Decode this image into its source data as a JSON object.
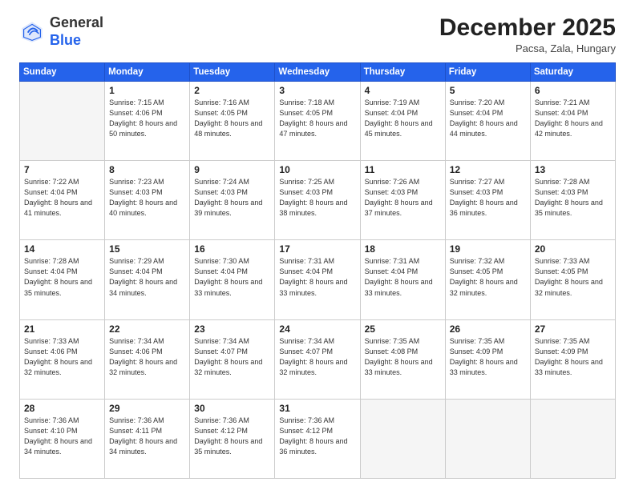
{
  "header": {
    "logo_general": "General",
    "logo_blue": "Blue",
    "month_title": "December 2025",
    "location": "Pacsa, Zala, Hungary"
  },
  "days_of_week": [
    "Sunday",
    "Monday",
    "Tuesday",
    "Wednesday",
    "Thursday",
    "Friday",
    "Saturday"
  ],
  "weeks": [
    [
      {
        "day": "",
        "info": ""
      },
      {
        "day": "1",
        "info": "Sunrise: 7:15 AM\nSunset: 4:06 PM\nDaylight: 8 hours\nand 50 minutes."
      },
      {
        "day": "2",
        "info": "Sunrise: 7:16 AM\nSunset: 4:05 PM\nDaylight: 8 hours\nand 48 minutes."
      },
      {
        "day": "3",
        "info": "Sunrise: 7:18 AM\nSunset: 4:05 PM\nDaylight: 8 hours\nand 47 minutes."
      },
      {
        "day": "4",
        "info": "Sunrise: 7:19 AM\nSunset: 4:04 PM\nDaylight: 8 hours\nand 45 minutes."
      },
      {
        "day": "5",
        "info": "Sunrise: 7:20 AM\nSunset: 4:04 PM\nDaylight: 8 hours\nand 44 minutes."
      },
      {
        "day": "6",
        "info": "Sunrise: 7:21 AM\nSunset: 4:04 PM\nDaylight: 8 hours\nand 42 minutes."
      }
    ],
    [
      {
        "day": "7",
        "info": "Sunrise: 7:22 AM\nSunset: 4:04 PM\nDaylight: 8 hours\nand 41 minutes."
      },
      {
        "day": "8",
        "info": "Sunrise: 7:23 AM\nSunset: 4:03 PM\nDaylight: 8 hours\nand 40 minutes."
      },
      {
        "day": "9",
        "info": "Sunrise: 7:24 AM\nSunset: 4:03 PM\nDaylight: 8 hours\nand 39 minutes."
      },
      {
        "day": "10",
        "info": "Sunrise: 7:25 AM\nSunset: 4:03 PM\nDaylight: 8 hours\nand 38 minutes."
      },
      {
        "day": "11",
        "info": "Sunrise: 7:26 AM\nSunset: 4:03 PM\nDaylight: 8 hours\nand 37 minutes."
      },
      {
        "day": "12",
        "info": "Sunrise: 7:27 AM\nSunset: 4:03 PM\nDaylight: 8 hours\nand 36 minutes."
      },
      {
        "day": "13",
        "info": "Sunrise: 7:28 AM\nSunset: 4:03 PM\nDaylight: 8 hours\nand 35 minutes."
      }
    ],
    [
      {
        "day": "14",
        "info": "Sunrise: 7:28 AM\nSunset: 4:04 PM\nDaylight: 8 hours\nand 35 minutes."
      },
      {
        "day": "15",
        "info": "Sunrise: 7:29 AM\nSunset: 4:04 PM\nDaylight: 8 hours\nand 34 minutes."
      },
      {
        "day": "16",
        "info": "Sunrise: 7:30 AM\nSunset: 4:04 PM\nDaylight: 8 hours\nand 33 minutes."
      },
      {
        "day": "17",
        "info": "Sunrise: 7:31 AM\nSunset: 4:04 PM\nDaylight: 8 hours\nand 33 minutes."
      },
      {
        "day": "18",
        "info": "Sunrise: 7:31 AM\nSunset: 4:04 PM\nDaylight: 8 hours\nand 33 minutes."
      },
      {
        "day": "19",
        "info": "Sunrise: 7:32 AM\nSunset: 4:05 PM\nDaylight: 8 hours\nand 32 minutes."
      },
      {
        "day": "20",
        "info": "Sunrise: 7:33 AM\nSunset: 4:05 PM\nDaylight: 8 hours\nand 32 minutes."
      }
    ],
    [
      {
        "day": "21",
        "info": "Sunrise: 7:33 AM\nSunset: 4:06 PM\nDaylight: 8 hours\nand 32 minutes."
      },
      {
        "day": "22",
        "info": "Sunrise: 7:34 AM\nSunset: 4:06 PM\nDaylight: 8 hours\nand 32 minutes."
      },
      {
        "day": "23",
        "info": "Sunrise: 7:34 AM\nSunset: 4:07 PM\nDaylight: 8 hours\nand 32 minutes."
      },
      {
        "day": "24",
        "info": "Sunrise: 7:34 AM\nSunset: 4:07 PM\nDaylight: 8 hours\nand 32 minutes."
      },
      {
        "day": "25",
        "info": "Sunrise: 7:35 AM\nSunset: 4:08 PM\nDaylight: 8 hours\nand 33 minutes."
      },
      {
        "day": "26",
        "info": "Sunrise: 7:35 AM\nSunset: 4:09 PM\nDaylight: 8 hours\nand 33 minutes."
      },
      {
        "day": "27",
        "info": "Sunrise: 7:35 AM\nSunset: 4:09 PM\nDaylight: 8 hours\nand 33 minutes."
      }
    ],
    [
      {
        "day": "28",
        "info": "Sunrise: 7:36 AM\nSunset: 4:10 PM\nDaylight: 8 hours\nand 34 minutes."
      },
      {
        "day": "29",
        "info": "Sunrise: 7:36 AM\nSunset: 4:11 PM\nDaylight: 8 hours\nand 34 minutes."
      },
      {
        "day": "30",
        "info": "Sunrise: 7:36 AM\nSunset: 4:12 PM\nDaylight: 8 hours\nand 35 minutes."
      },
      {
        "day": "31",
        "info": "Sunrise: 7:36 AM\nSunset: 4:12 PM\nDaylight: 8 hours\nand 36 minutes."
      },
      {
        "day": "",
        "info": ""
      },
      {
        "day": "",
        "info": ""
      },
      {
        "day": "",
        "info": ""
      }
    ]
  ]
}
